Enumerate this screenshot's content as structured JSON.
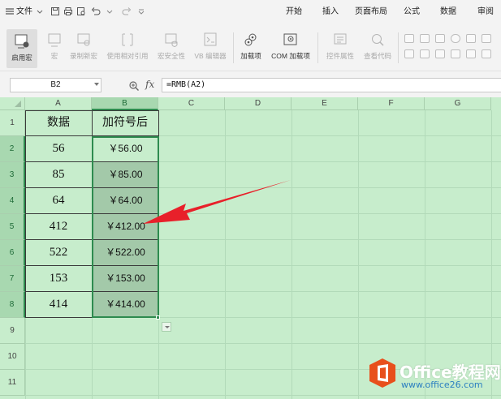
{
  "menubar": {
    "file_label": "文件",
    "tabs": [
      {
        "label": "开始"
      },
      {
        "label": "插入"
      },
      {
        "label": "页面布局"
      },
      {
        "label": "公式"
      },
      {
        "label": "数据"
      },
      {
        "label": "审阅"
      }
    ]
  },
  "ribbon": {
    "buttons": [
      {
        "label": "启用宏",
        "icon": "enable-macro-icon",
        "state": "active"
      },
      {
        "label": "宏",
        "icon": "macro-icon",
        "state": "disabled"
      },
      {
        "label": "录制新宏",
        "icon": "record-macro-icon",
        "state": "disabled"
      },
      {
        "label": "使用相对引用",
        "icon": "relative-reference-icon",
        "state": "disabled"
      },
      {
        "label": "宏安全性",
        "icon": "macro-security-icon",
        "state": "disabled"
      },
      {
        "label": "VB 编辑器",
        "icon": "vb-editor-icon",
        "state": "disabled"
      },
      {
        "label": "加载项",
        "icon": "add-ins-icon",
        "state": "enabled"
      },
      {
        "label": "COM 加载项",
        "icon": "com-add-ins-icon",
        "state": "enabled"
      },
      {
        "label": "控件属性",
        "icon": "control-properties-icon",
        "state": "disabled"
      },
      {
        "label": "查看代码",
        "icon": "view-code-icon",
        "state": "disabled"
      }
    ]
  },
  "formula_bar": {
    "name_box": "B2",
    "fx_label": "fx",
    "formula": "=RMB(A2)"
  },
  "sheet": {
    "columns": [
      "A",
      "B",
      "C",
      "D",
      "E",
      "F",
      "G"
    ],
    "selected_column": "B",
    "rows": [
      "1",
      "2",
      "3",
      "4",
      "5",
      "6",
      "7",
      "8",
      "9",
      "10",
      "11"
    ],
    "selected_rows": [
      "2",
      "3",
      "4",
      "5",
      "6",
      "7",
      "8"
    ],
    "header_a": "数据",
    "header_b": "加符号后",
    "data": [
      {
        "a": "56",
        "b": "￥56.00"
      },
      {
        "a": "85",
        "b": "￥85.00"
      },
      {
        "a": "64",
        "b": "￥64.00"
      },
      {
        "a": "412",
        "b": "￥412.00"
      },
      {
        "a": "522",
        "b": "￥522.00"
      },
      {
        "a": "153",
        "b": "￥153.00"
      },
      {
        "a": "414",
        "b": "￥414.00"
      }
    ]
  },
  "annotation": {
    "arrow_color": "#e8202a"
  },
  "watermark": {
    "title": "Office教程网",
    "url": "www.office26.com",
    "logo_color": "#e8501c"
  }
}
